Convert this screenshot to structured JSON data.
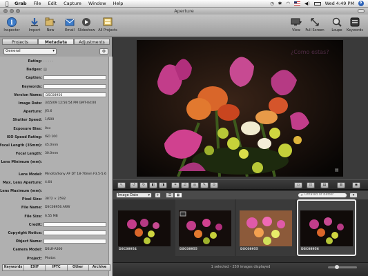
{
  "menubar": {
    "app": "Grab",
    "items": [
      "File",
      "Edit",
      "Capture",
      "Window",
      "Help"
    ],
    "clock": "Wed 4:49 PM"
  },
  "window": {
    "title": "Aperture"
  },
  "toolbar": {
    "inspector": "Inspector",
    "import": "Import",
    "new": "New",
    "email": "Email",
    "slideshow": "Slideshow",
    "all_projects": "All Projects",
    "view": "View",
    "full_screen": "Full Screen",
    "loupe": "Loupe",
    "keywords": "Keywords"
  },
  "inspector": {
    "tabs": [
      "Projects",
      "Metadata",
      "Adjustments"
    ],
    "preset": "General",
    "fields": [
      {
        "label": "Rating:",
        "value": "",
        "type": "stars"
      },
      {
        "label": "Badges:",
        "value": "",
        "type": "badge"
      },
      {
        "label": "Caption:",
        "value": "",
        "type": "box"
      },
      {
        "label": "Keywords:",
        "value": "",
        "type": "box"
      },
      {
        "label": "Version Name:",
        "value": "DSC08956",
        "type": "box"
      },
      {
        "label": "Image Date:",
        "value": "3/15/09 12:56:54 PM GMT-04:00",
        "type": "text"
      },
      {
        "label": "Aperture:",
        "value": "ƒ/5.6",
        "type": "text"
      },
      {
        "label": "Shutter Speed:",
        "value": "1/500",
        "type": "text"
      },
      {
        "label": "Exposure Bias:",
        "value": "0ev",
        "type": "text"
      },
      {
        "label": "ISO Speed Rating:",
        "value": "ISO 100",
        "type": "text"
      },
      {
        "label": "Focal Length (35mm):",
        "value": "45.0mm",
        "type": "text"
      },
      {
        "label": "Focal Length:",
        "value": "30.0mm",
        "type": "text"
      },
      {
        "label": "Lens Minimum (mm):",
        "value": "",
        "type": "text"
      },
      {
        "label": "Lens Model:",
        "value": "Minolta/Sony AF DT 18-70mm F3.5-5.6 (D)",
        "type": "text"
      },
      {
        "label": "Max. Lens Aperture:",
        "value": "4.64",
        "type": "text"
      },
      {
        "label": "Lens Maximum (mm):",
        "value": "",
        "type": "text"
      },
      {
        "label": "Pixel Size:",
        "value": "3872 × 2592",
        "type": "text"
      },
      {
        "label": "File Name:",
        "value": "DSC08956.ARW",
        "type": "text"
      },
      {
        "label": "File Size:",
        "value": "6.55 MB",
        "type": "text"
      },
      {
        "label": "Credit:",
        "value": "",
        "type": "box"
      },
      {
        "label": "Copyright Notice:",
        "value": "",
        "type": "box"
      },
      {
        "label": "Object Name:",
        "value": "",
        "type": "box"
      },
      {
        "label": "Camera Model:",
        "value": "DSLR-A300",
        "type": "text"
      },
      {
        "label": "Project:",
        "value": "Photos",
        "type": "text"
      }
    ],
    "bottom_tabs": [
      "Keywords",
      "EXIF",
      "IPTC",
      "Other",
      "Archive"
    ]
  },
  "browser": {
    "sort": "Image Date",
    "search_placeholder": "Unrated or Better",
    "thumbnails": [
      "DSC08954",
      "DSC08955",
      "DSC08955",
      "DSC08956"
    ],
    "status": "1 selected - 250 images displayed"
  },
  "colors": {
    "accent_blue": "#3d7cc9",
    "flower_magenta": "#c23d8a",
    "flower_orange": "#e2792f",
    "flower_yellow": "#cfd640"
  }
}
